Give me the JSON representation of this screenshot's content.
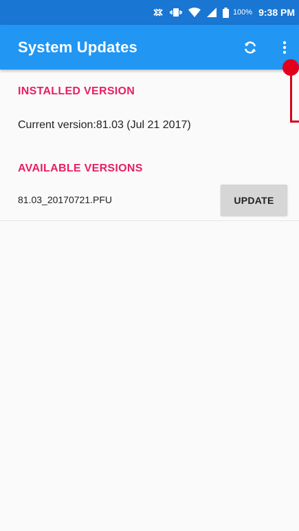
{
  "status_bar": {
    "icons": [
      "nfc-icon",
      "vibrate-icon",
      "wifi-icon",
      "signal-icon",
      "battery-icon"
    ],
    "battery": "100%",
    "time": "9:38 PM"
  },
  "app_bar": {
    "title": "System Updates",
    "actions": [
      "refresh-icon",
      "overflow-menu-icon"
    ],
    "color": "#2196f3"
  },
  "installed": {
    "header": "INSTALLED VERSION",
    "current": "Current version:81.03 (Jul 21 2017)"
  },
  "available": {
    "header": "AVAILABLE VERSIONS",
    "items": [
      {
        "name": "81.03_20170721.PFU",
        "button": "UPDATE"
      }
    ]
  },
  "colors": {
    "status_bar": "#1976d2",
    "accent": "#e91e63",
    "marker": "#e3001b"
  }
}
